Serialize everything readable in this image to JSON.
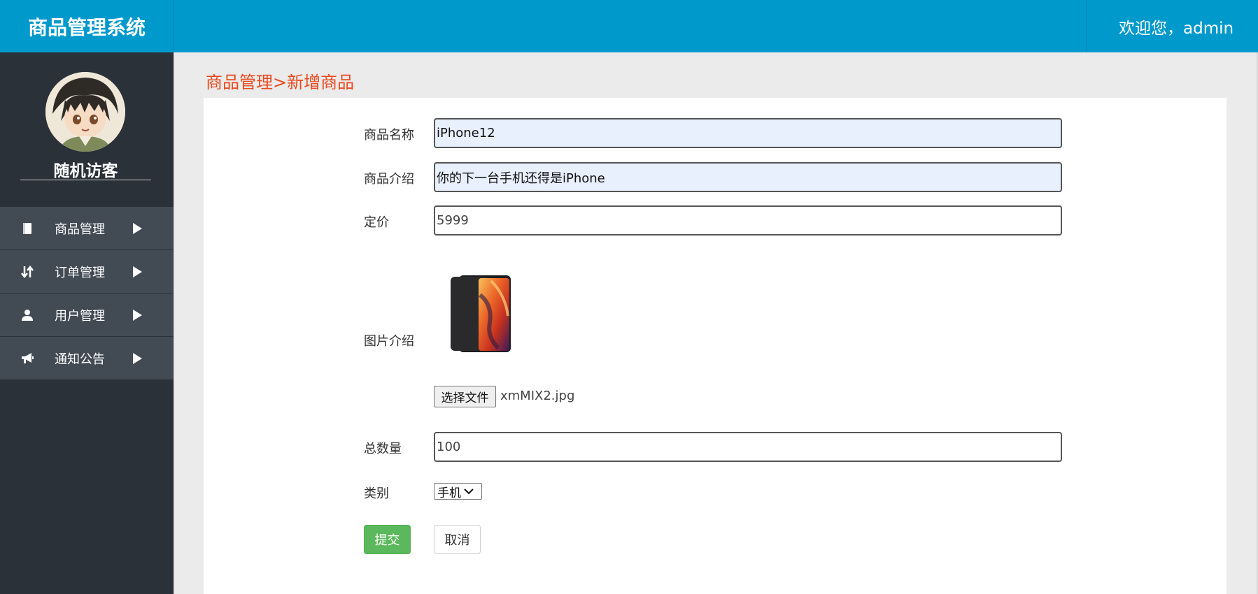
{
  "header": {
    "title": "商品管理系统",
    "welcome": "欢迎您，admin"
  },
  "sidebar": {
    "avatar_icon": "avatar-image",
    "username": "随机访客",
    "items": [
      {
        "label": "商品管理",
        "icon": "book-icon"
      },
      {
        "label": "订单管理",
        "icon": "sort-arrows-icon"
      },
      {
        "label": "用户管理",
        "icon": "user-icon"
      },
      {
        "label": "通知公告",
        "icon": "megaphone-icon"
      }
    ]
  },
  "main": {
    "breadcrumb": "商品管理>新增商品",
    "form": {
      "name_label": "商品名称",
      "name_value": "iPhone12",
      "intro_label": "商品介绍",
      "intro_value": "你的下一台手机还得是iPhone",
      "price_label": "定价",
      "price_value": "5999",
      "image_label": "图片介绍",
      "file_button": "选择文件",
      "file_name": "xmMIX2.jpg",
      "quantity_label": "总数量",
      "quantity_value": "100",
      "category_label": "类别",
      "category_value": "手机",
      "submit_label": "提交",
      "cancel_label": "取消"
    }
  },
  "colors": {
    "header": "#0099cc",
    "sidebar": "#2b3138",
    "nav_item": "#424a54",
    "breadcrumb": "#e8491d",
    "submit": "#5cb85c",
    "input_autofill": "#e8f0fe"
  }
}
